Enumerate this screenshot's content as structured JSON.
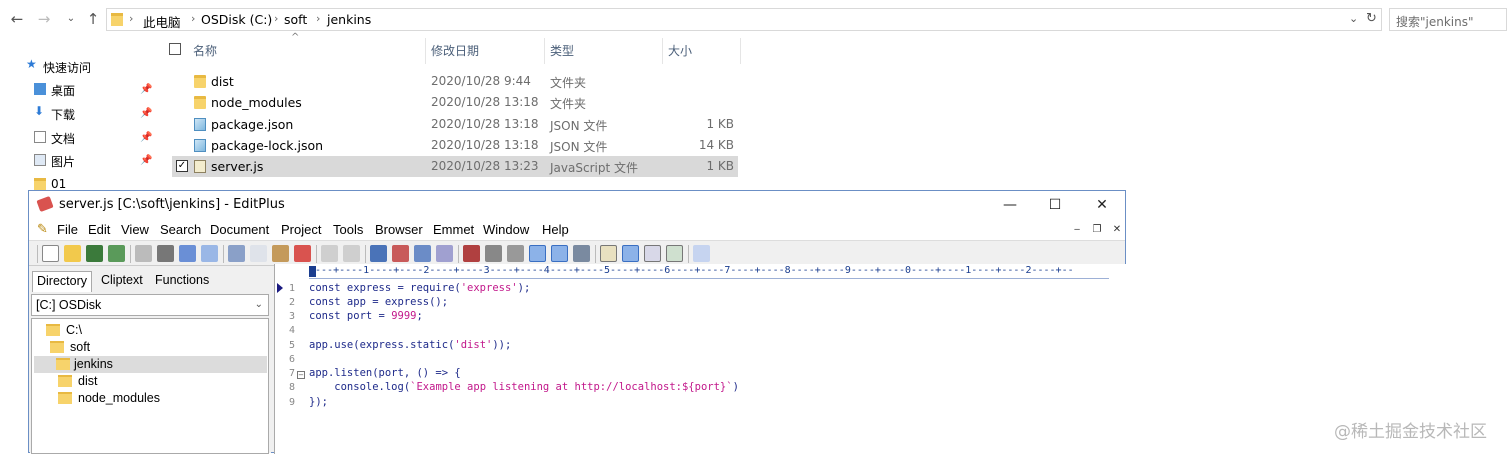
{
  "explorer": {
    "address": {
      "crumbs": [
        "此电脑",
        "OSDisk (C:)",
        "soft",
        "jenkins"
      ]
    },
    "search_placeholder": "搜索\"jenkins\"",
    "nav": {
      "quick_access": "快速访问",
      "items": [
        {
          "label": "桌面",
          "pinned": true
        },
        {
          "label": "下载",
          "pinned": true
        },
        {
          "label": "文档",
          "pinned": true
        },
        {
          "label": "图片",
          "pinned": true
        },
        {
          "label": "01",
          "pinned": false
        }
      ]
    },
    "columns": {
      "name": "名称",
      "date": "修改日期",
      "type": "类型",
      "size": "大小"
    },
    "files": [
      {
        "name": "dist",
        "date": "2020/10/28 9:44",
        "type": "文件夹",
        "size": "",
        "icon": "folder-icon"
      },
      {
        "name": "node_modules",
        "date": "2020/10/28 13:18",
        "type": "文件夹",
        "size": "",
        "icon": "folder-icon"
      },
      {
        "name": "package.json",
        "date": "2020/10/28 13:18",
        "type": "JSON 文件",
        "size": "1 KB",
        "icon": "json-file-icon"
      },
      {
        "name": "package-lock.json",
        "date": "2020/10/28 13:18",
        "type": "JSON 文件",
        "size": "14 KB",
        "icon": "json-file-icon"
      },
      {
        "name": "server.js",
        "date": "2020/10/28 13:23",
        "type": "JavaScript 文件",
        "size": "1 KB",
        "icon": "js-file-icon",
        "selected": true
      }
    ]
  },
  "editplus": {
    "title": "server.js [C:\\soft\\jenkins] - EditPlus",
    "menu": [
      "File",
      "Edit",
      "View",
      "Search",
      "Document",
      "Project",
      "Tools",
      "Browser",
      "Emmet",
      "Window",
      "Help"
    ],
    "tabs": {
      "directory": "Directory",
      "cliptext": "Cliptext",
      "functions": "Functions"
    },
    "drive": "[C:] OSDisk",
    "tree": [
      "C:\\",
      "soft",
      "jenkins",
      "dist",
      "node_modules"
    ],
    "ruler": "----+----1----+----2----+----3----+----4----+----5----+----6----+----7----+----8----+----9----+----0----+----1----+----2----+--",
    "code": {
      "l1a": "const express = require(",
      "l1s": "'express'",
      "l1b": ");",
      "l2": "const app = express();",
      "l3a": "const port = ",
      "l3n": "9999",
      "l3b": ";",
      "l5a": "app.use(express.static(",
      "l5s": "'dist'",
      "l5b": "));",
      "l7": "app.listen(port, () => {",
      "l8a": "    console.log(",
      "l8s": "`Example app listening at http://localhost:${port}`",
      "l8b": ")",
      "l9": "});"
    },
    "line_numbers": [
      "1",
      "2",
      "3",
      "4",
      "5",
      "6",
      "7",
      "8",
      "9"
    ]
  },
  "watermark": "@稀土掘金技术社区"
}
